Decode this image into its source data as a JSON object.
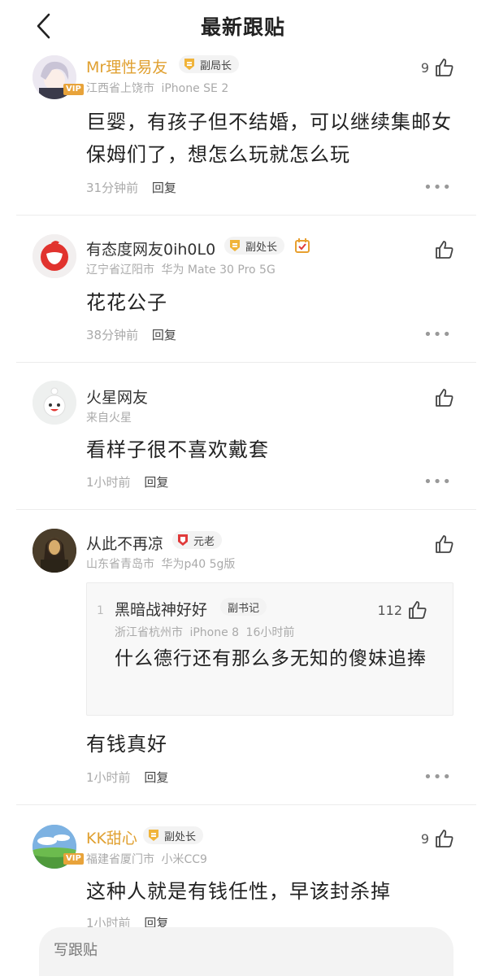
{
  "header": {
    "title": "最新跟贴"
  },
  "comments": [
    {
      "username": "Mr理性易友",
      "badge": "副局长",
      "vip": "VIP",
      "location": "江西省上饶市",
      "device": "iPhone SE 2",
      "likes": "9",
      "text": "巨婴，有孩子但不结婚，可以继续集邮女保姆们了，想怎么玩就怎么玩",
      "time": "31分钟前",
      "reply": "回复"
    },
    {
      "username": "有态度网友0ih0L0",
      "badge": "副处长",
      "location": "辽宁省辽阳市",
      "device": "华为 Mate 30 Pro 5G",
      "text": "花花公子",
      "time": "38分钟前",
      "reply": "回复"
    },
    {
      "username": "火星网友",
      "location": "来自火星",
      "text": "看样子很不喜欢戴套",
      "time": "1小时前",
      "reply": "回复"
    },
    {
      "username": "从此不再凉",
      "badge": "元老",
      "location": "山东省青岛市",
      "device": "华为p40 5g版",
      "quote": {
        "floor": "1",
        "username": "黑暗战神好好",
        "badge": "副书记",
        "likes": "112",
        "location": "浙江省杭州市",
        "device": "iPhone 8",
        "time": "16小时前",
        "text": "什么德行还有那么多无知的傻妹追捧"
      },
      "text": "有钱真好",
      "time": "1小时前",
      "reply": "回复"
    },
    {
      "username": "KK甜心",
      "badge": "副处长",
      "vip": "VIP",
      "location": "福建省厦门市",
      "device": "小米CC9",
      "likes": "9",
      "text": "这种人就是有钱任性，早该封杀掉",
      "time": "1小时前",
      "reply": "回复"
    }
  ],
  "more_icon": "•••",
  "bottom_bar": {
    "placeholder": "写跟贴"
  },
  "colors": {
    "gold_name": "#e0a030",
    "badge_gold": "#f0b43a",
    "badge_red": "#e03a3a"
  }
}
